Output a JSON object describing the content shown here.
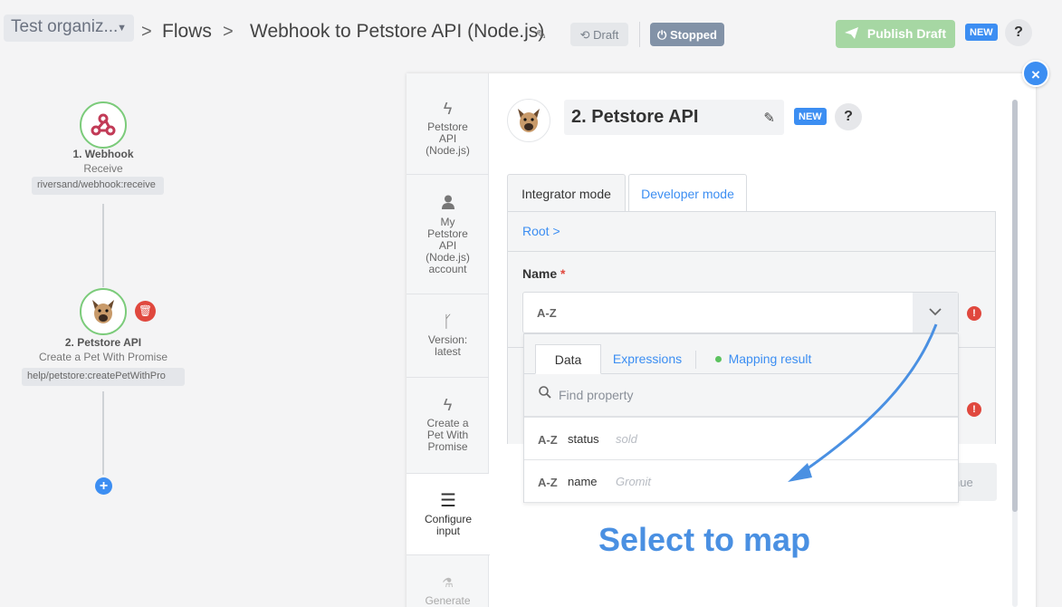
{
  "header": {
    "org_name": "Test organiz...",
    "breadcrumb_sep": ">",
    "breadcrumb_flows": "Flows",
    "flow_title": "Webhook to Petstore API (Node.js)",
    "draft_label": "Draft",
    "stopped_label": "Stopped",
    "publish_label": "Publish Draft",
    "new_badge": "NEW",
    "help_label": "?"
  },
  "flow": {
    "nodes": [
      {
        "title": "1. Webhook",
        "subtitle": "Receive",
        "path": "riversand/webhook:receive"
      },
      {
        "title": "2. Petstore API",
        "subtitle": "Create a Pet With Promise",
        "path": "help/petstore:createPetWithPro"
      }
    ]
  },
  "panel": {
    "close_label": "×",
    "steps": [
      {
        "icon": "lightning-icon",
        "label": "Petstore API (Node.js)"
      },
      {
        "icon": "user-icon",
        "label": "My Petstore API (Node.js) account"
      },
      {
        "icon": "branch-icon",
        "label": "Version: latest"
      },
      {
        "icon": "lightning-icon",
        "label": "Create a Pet With Promise"
      },
      {
        "icon": "menu-icon",
        "label": "Configure input"
      },
      {
        "icon": "flask-icon",
        "label": "Generate sample"
      }
    ],
    "step_title": "2. Petstore API",
    "new_badge": "NEW",
    "help_label": "?",
    "tabs": [
      "Integrator mode",
      "Developer mode"
    ],
    "breadcrumb": "Root >",
    "field_label": "Name",
    "required_mark": "*",
    "type_badge": "A-Z",
    "continue_label": "nue"
  },
  "mapping_dropdown": {
    "tabs": [
      "Data",
      "Expressions",
      "Mapping result"
    ],
    "search_placeholder": "Find property",
    "properties": [
      {
        "type": "A-Z",
        "name": "status",
        "sample": "sold"
      },
      {
        "type": "A-Z",
        "name": "name",
        "sample": "Gromit"
      }
    ]
  },
  "annotation": {
    "callout_text": "Select to map",
    "arrow_color": "#4a90e2"
  },
  "colors": {
    "accent": "#3c8ef2",
    "success": "#7bcb7a",
    "danger": "#e0483e",
    "stopped": "#8292a7",
    "publish": "#a6d7a3"
  }
}
